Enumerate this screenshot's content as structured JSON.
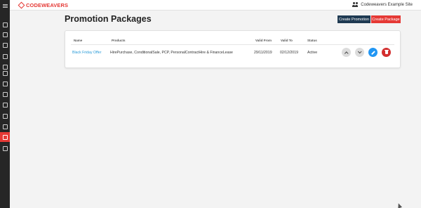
{
  "header": {
    "brand": "CODEWEAVERS",
    "site_name": "Codeweavers Example Site",
    "site_icon": "users-icon",
    "logo_icon": "codeweavers-logo-icon"
  },
  "sidebar": {
    "items": [
      {
        "name": "menu-toggle",
        "icon": "hamburger-icon",
        "active": false
      },
      {
        "name": "dashboard",
        "icon": "dashboard-icon",
        "active": false
      },
      {
        "name": "reports",
        "icon": "reports-icon",
        "active": false
      },
      {
        "name": "vehicles",
        "icon": "car-icon",
        "active": false
      },
      {
        "name": "pricing",
        "icon": "price-icon",
        "active": false
      },
      {
        "name": "calculator",
        "icon": "calculator-icon",
        "active": false
      },
      {
        "name": "tags",
        "icon": "tag-icon",
        "active": false
      },
      {
        "name": "feeds",
        "icon": "rss-icon",
        "active": false
      },
      {
        "name": "documents",
        "icon": "documents-icon",
        "active": false
      },
      {
        "name": "filters",
        "icon": "filter-icon",
        "active": false
      },
      {
        "name": "checklists",
        "icon": "checklist-icon",
        "active": false
      },
      {
        "name": "people",
        "icon": "person-icon",
        "active": false
      },
      {
        "name": "promotions",
        "icon": "promotion-icon",
        "active": true
      },
      {
        "name": "packages",
        "icon": "packages-icon",
        "active": false
      }
    ]
  },
  "page": {
    "title": "Promotion Packages",
    "create_promotion_label": "Create Promotion",
    "create_package_label": "Create Package"
  },
  "table": {
    "headers": [
      "Name",
      "Products",
      "Valid From",
      "Valid To",
      "Status"
    ],
    "rows": [
      {
        "name": "Black Friday Offer",
        "products": "HirePurchase, ConditionalSale, PCP, PersonalContractHire & FinanceLease",
        "valid_from": "29/11/2019",
        "valid_to": "02/12/2019",
        "status": "Active",
        "actions": [
          "move-up-icon",
          "move-down-icon",
          "edit-icon",
          "delete-icon"
        ]
      }
    ]
  },
  "colors": {
    "accent": "#e53935",
    "nav_dark": "#1f3a52",
    "link": "#2a9bd8",
    "edit": "#2196f3",
    "delete": "#d32f2f"
  }
}
